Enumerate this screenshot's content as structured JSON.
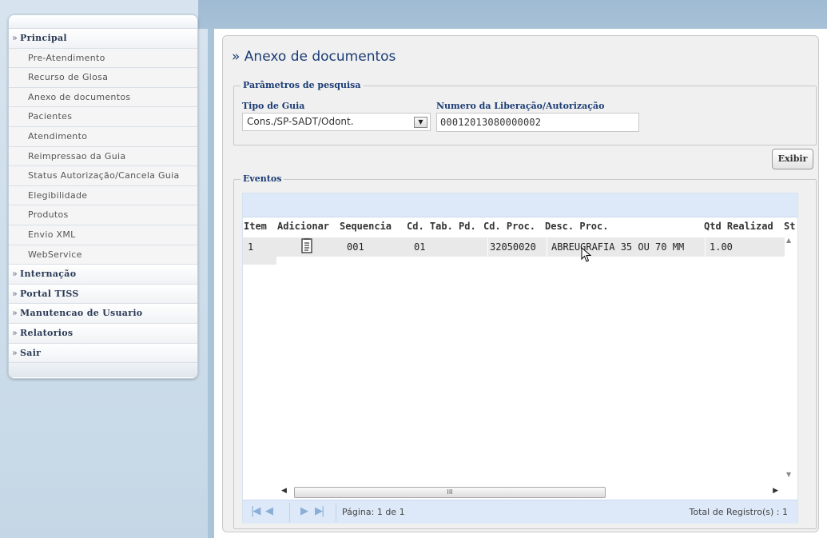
{
  "sidebar": {
    "items": [
      {
        "label": "Principal",
        "type": "head"
      },
      {
        "label": "Pre-Atendimento",
        "type": "sub"
      },
      {
        "label": "Recurso de Glosa",
        "type": "sub"
      },
      {
        "label": "Anexo de documentos",
        "type": "sub"
      },
      {
        "label": "Pacientes",
        "type": "sub"
      },
      {
        "label": "Atendimento",
        "type": "sub"
      },
      {
        "label": "Reimpressao da Guia",
        "type": "sub"
      },
      {
        "label": "Status Autorização/Cancela Guia",
        "type": "sub"
      },
      {
        "label": "Elegibilidade",
        "type": "sub"
      },
      {
        "label": "Produtos",
        "type": "sub"
      },
      {
        "label": "Envio XML",
        "type": "sub"
      },
      {
        "label": "WebService",
        "type": "sub"
      },
      {
        "label": "Internação",
        "type": "head"
      },
      {
        "label": "Portal TISS",
        "type": "head"
      },
      {
        "label": "Manutencao de Usuario",
        "type": "head"
      },
      {
        "label": "Relatorios",
        "type": "head"
      },
      {
        "label": "Sair",
        "type": "head"
      }
    ],
    "head_prefix": "»"
  },
  "page": {
    "title": "» Anexo de documentos"
  },
  "search": {
    "legend": "Parâmetros de pesquisa",
    "tipo_label": "Tipo de Guia",
    "tipo_value": "Cons./SP-SADT/Odont.",
    "numero_label": "Numero da Liberação/Autorização",
    "numero_value": "00012013080000002",
    "exibir_label": "Exibir"
  },
  "eventos": {
    "legend": "Eventos",
    "columns": [
      "Item",
      "Adicionar",
      "Sequencia",
      "Cd. Tab. Pd.",
      "Cd. Proc.",
      "Desc. Proc.",
      "Qtd Realizad",
      "St"
    ],
    "rows": [
      {
        "item": "1",
        "sequencia": "001",
        "cd_tab": "01",
        "cd_proc": "32050020",
        "desc": "ABREUGRAFIA 35 OU 70 MM",
        "qtd": "1.00"
      }
    ],
    "hscroll_grip": "III",
    "pager": {
      "page_text": "Página: 1 de 1",
      "total_text": "Total de Registro(s) : 1"
    }
  }
}
